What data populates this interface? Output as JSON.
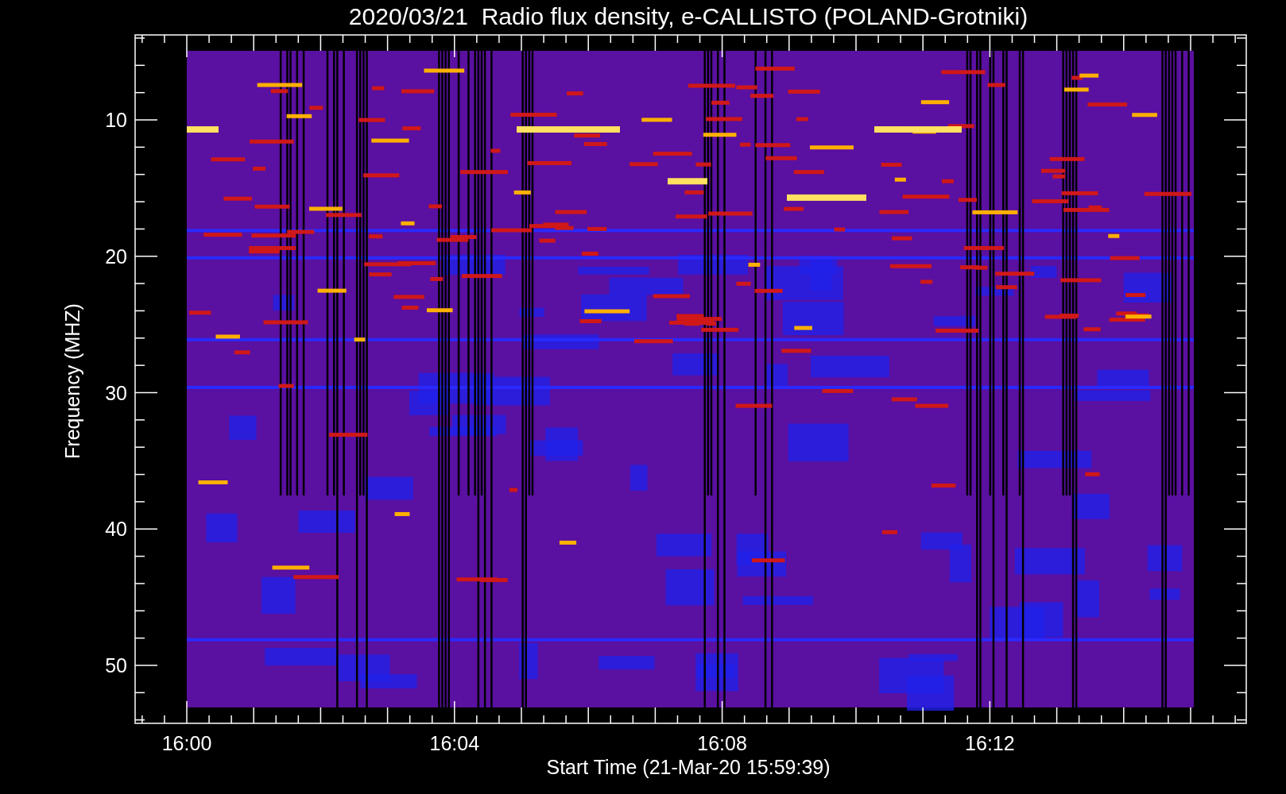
{
  "title": "2020/03/21  Radio flux density, e-CALLISTO (POLAND-Grotniki)",
  "y_axis": {
    "label": "Frequency (MHZ)",
    "ticks": [
      "10",
      "20",
      "30",
      "40",
      "50"
    ]
  },
  "x_axis": {
    "label": "Start Time (21-Mar-20 15:59:39)",
    "ticks": [
      "16:00",
      "16:04",
      "16:08",
      "16:12"
    ]
  }
}
